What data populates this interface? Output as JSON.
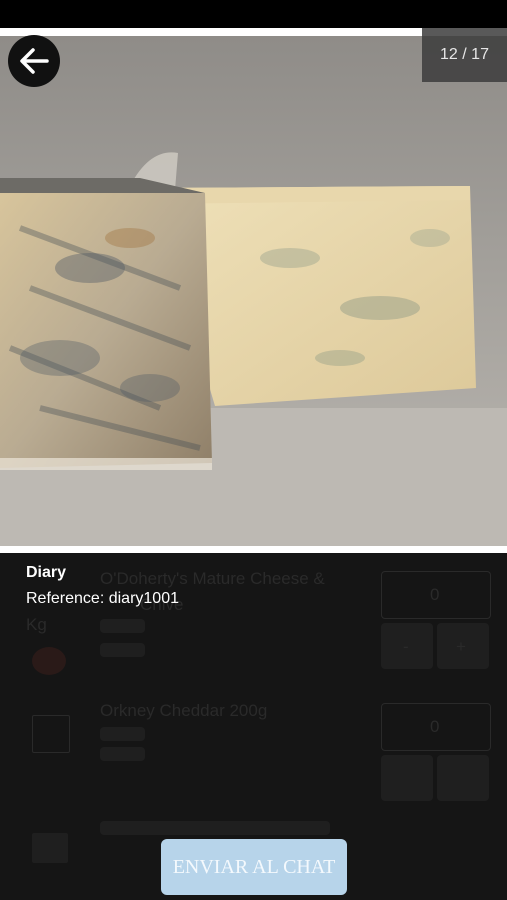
{
  "gallery": {
    "counter": "12 / 17",
    "image_name": "blue-cheese-photo"
  },
  "caption": {
    "title": "Diary",
    "reference": "Reference: diary1001"
  },
  "background_list": {
    "item1_title": "O'Doherty's Mature Cheese &",
    "item1_line2": "Chive",
    "item1_unit": "Kg",
    "item1_qty": "0",
    "item2_title": "Orkney Cheddar 200g",
    "item2_qty": "0",
    "minus": "-",
    "plus": "+"
  },
  "actions": {
    "send_label": "ENVIAR AL CHAT"
  },
  "colors": {
    "send_button": "#b7d4ea",
    "panel": "#151515"
  }
}
